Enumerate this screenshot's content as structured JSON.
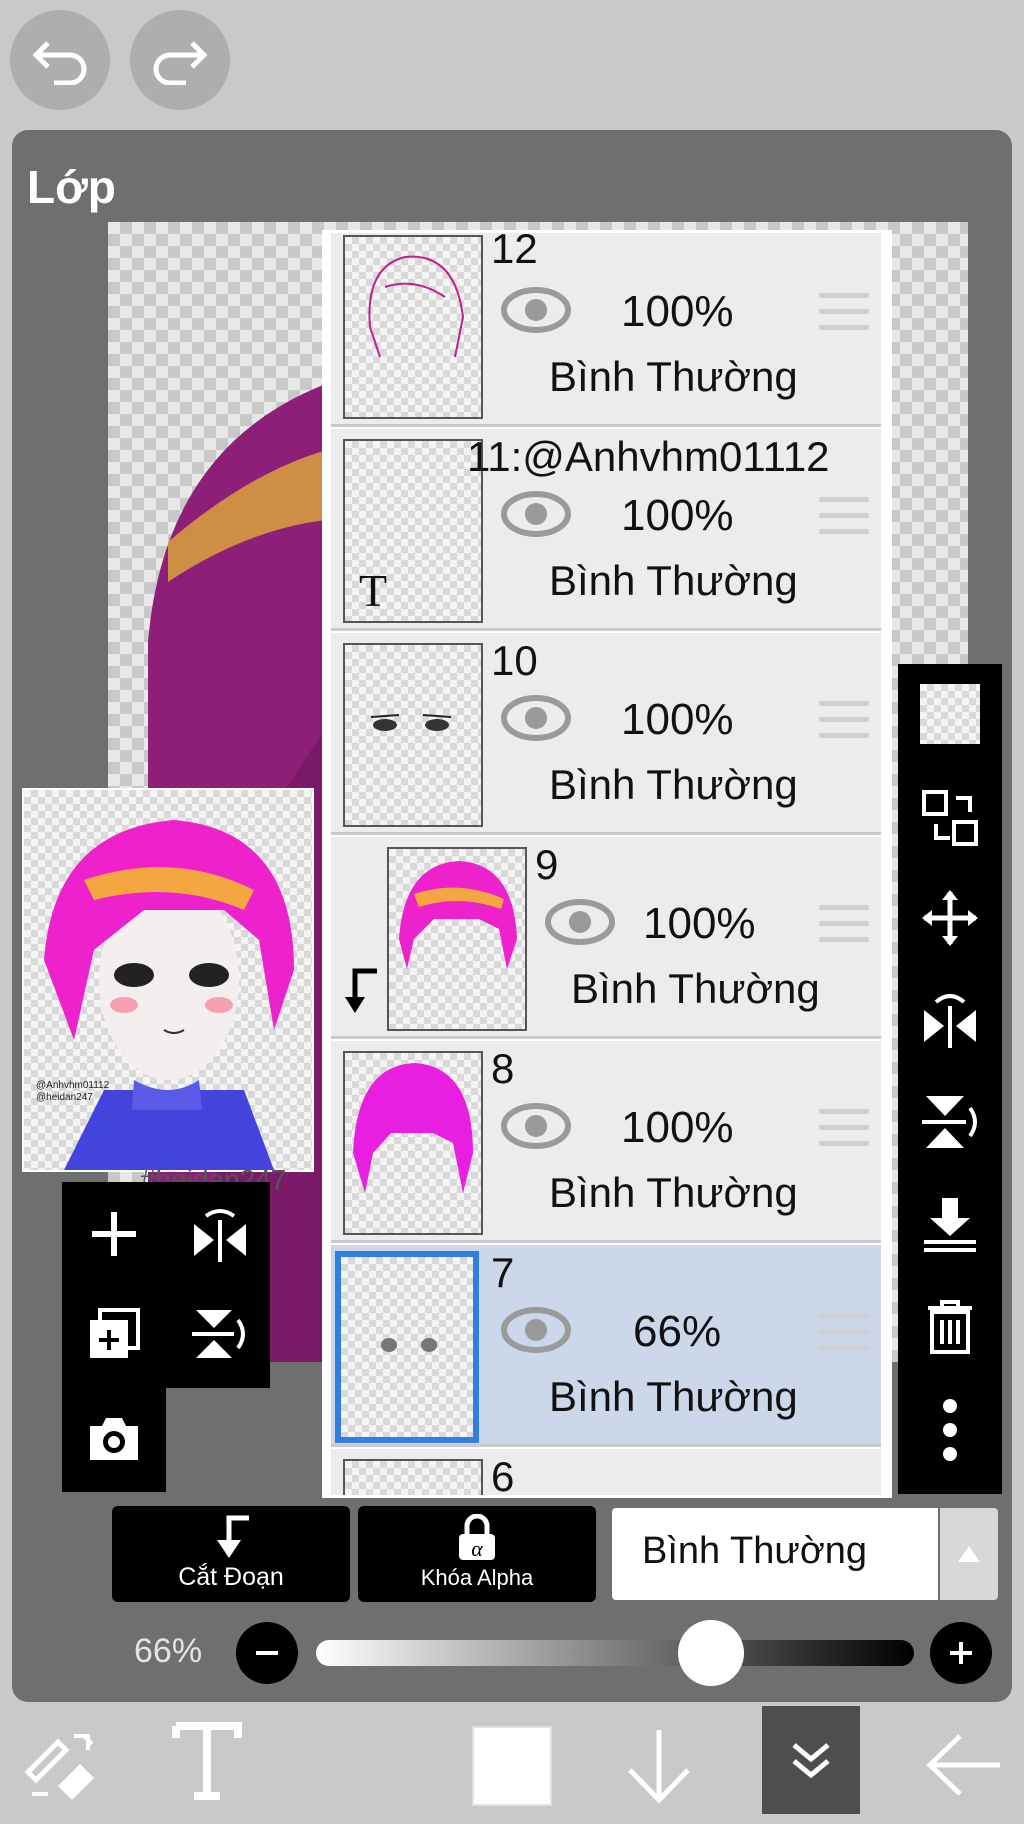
{
  "panel": {
    "title": "Lớp"
  },
  "layers": [
    {
      "name": "12",
      "opacity": "100%",
      "blend": "Bình Thường",
      "thumb": "hair-outline"
    },
    {
      "name": "11:@Anhvhm01112",
      "opacity": "100%",
      "blend": "Bình Thường",
      "thumb": "text",
      "thumb_text": "T"
    },
    {
      "name": "10",
      "opacity": "100%",
      "blend": "Bình Thường",
      "thumb": "eyes"
    },
    {
      "name": "9",
      "opacity": "100%",
      "blend": "Bình Thường",
      "thumb": "hair-color",
      "clipped": true
    },
    {
      "name": "8",
      "opacity": "100%",
      "blend": "Bình Thường",
      "thumb": "hair-magenta"
    },
    {
      "name": "7",
      "opacity": "66%",
      "blend": "Bình Thường",
      "thumb": "dots",
      "selected": true
    },
    {
      "name": "6"
    }
  ],
  "buttons": {
    "clipping": "Cắt Đoạn",
    "alpha_lock": "Khóa Alpha",
    "blend_mode": "Bình Thường"
  },
  "opacity_slider": {
    "label": "66%",
    "value": 0.66
  },
  "preview": {
    "signature_lines": [
      "@Anhvhm01112",
      "@heidan247"
    ],
    "watermark": "#heidan247"
  },
  "colors": {
    "accent": "#2f7ee0",
    "selected_row": "#cdd7ea",
    "hair": "#e81fc8",
    "panel": "#6f6f6f"
  }
}
